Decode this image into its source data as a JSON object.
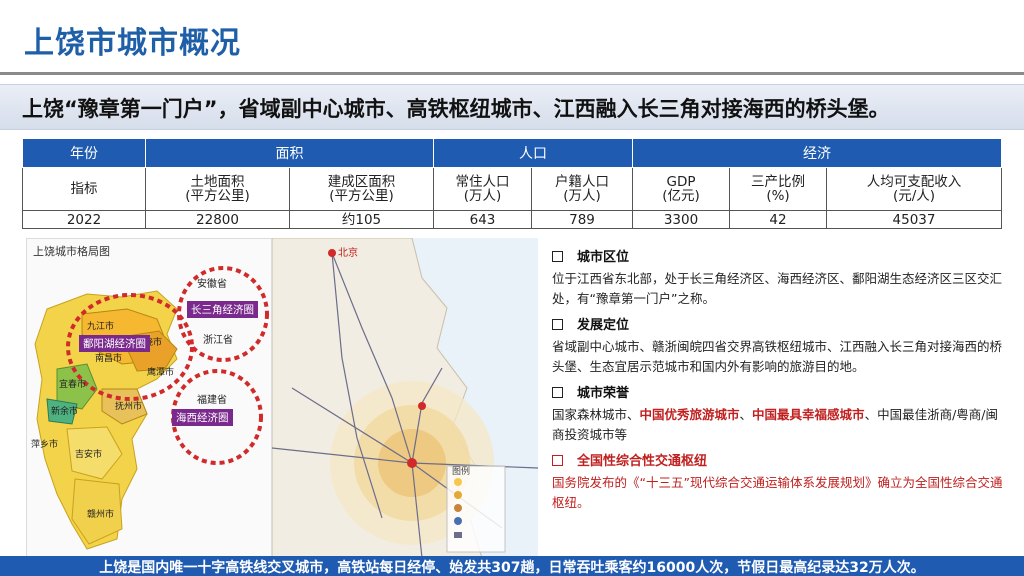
{
  "title": "上饶市城市概况",
  "banner": "上饶“豫章第一门户”，省域副中心城市、高铁枢纽城市、江西融入长三角对接海西的桥头堡。",
  "table": {
    "groups": [
      "年份",
      "面积",
      "人口",
      "经济"
    ],
    "row_label_indicator": "指标",
    "indicators": [
      {
        "name": "土地面积",
        "unit": "(平方公里)"
      },
      {
        "name": "建成区面积",
        "unit": "(平方公里)"
      },
      {
        "name": "常住人口",
        "unit": "(万人)"
      },
      {
        "name": "户籍人口",
        "unit": "(万人)"
      },
      {
        "name": "GDP",
        "unit": "(亿元)"
      },
      {
        "name": "三产比例",
        "unit": "(%)"
      },
      {
        "name": "人均可支配收入",
        "unit": "(元/人)"
      }
    ],
    "year": "2022",
    "values": [
      "22800",
      "约105",
      "643",
      "789",
      "3300",
      "42",
      "45037"
    ]
  },
  "left_map": {
    "title": "上饶城市格局图",
    "labels": [
      "安徽省",
      "浙江省",
      "福建省",
      "九江市",
      "南昌市",
      "上饶市",
      "宜春市",
      "新余市",
      "抚州市",
      "萍乡市",
      "吉安市",
      "赣州市",
      "鹰潭市"
    ],
    "tags": [
      "长三角经济圈",
      "鄱阳湖经济圈",
      "海西经济圈"
    ]
  },
  "right_map": {
    "labels": [
      "北京",
      "图例"
    ]
  },
  "sections": [
    {
      "heading": "城市区位",
      "body": "位于江西省东北部，处于长三角经济区、海西经济区、鄱阳湖生态经济区三区交汇处，有“豫章第一门户”之称。"
    },
    {
      "heading": "发展定位",
      "body": "省域副中心城市、赣浙闽皖四省交界高铁枢纽城市、江西融入长三角对接海西的桥头堡、生态宜居示范城市和国内外有影响的旅游目的地。"
    },
    {
      "heading": "城市荣誉",
      "body_pre": "国家森林城市、",
      "hl1": "中国优秀旅游城市",
      "sep": "、",
      "hl2": "中国最具幸福感城市",
      "body_post": "、中国最佳浙商/粤商/闽商投资城市等"
    },
    {
      "heading": "全国性综合性交通枢纽",
      "body": "国务院发布的《“十三五”现代综合交通运输体系发展规划》确立为全国性综合交通枢纽。"
    }
  ],
  "footer": "上饶是国内唯一十字高铁线交叉城市，高铁站每日经停、始发共307趟，日常吞吐乘客约16000人次，节假日最高纪录达32万人次。",
  "colors": {
    "brand_blue": "#1f5bb0",
    "title_blue": "#1f5fa8",
    "highlight_red": "#c0201f",
    "tag_purple": "#7a2a8c"
  }
}
